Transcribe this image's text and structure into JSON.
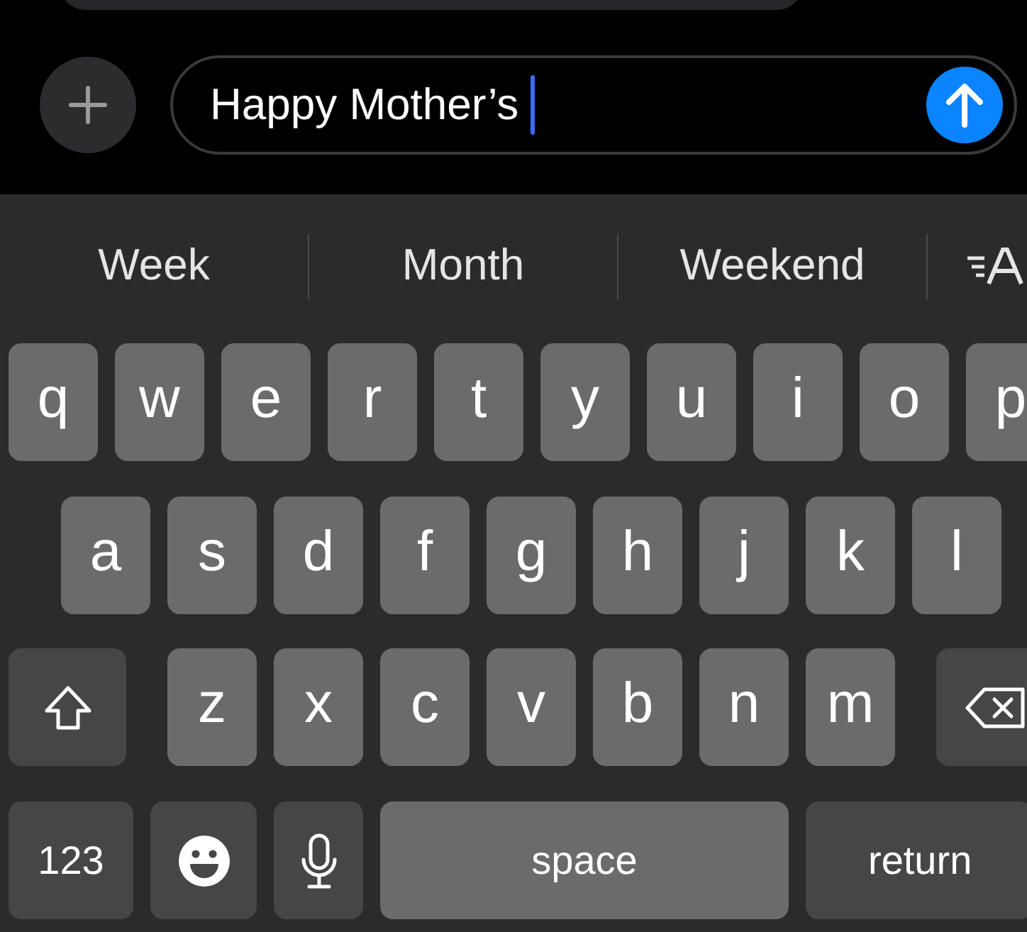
{
  "composer": {
    "value": "Happy Mother’s"
  },
  "suggestions": [
    "Week",
    "Month",
    "Weekend"
  ],
  "keyboard": {
    "rows": [
      {
        "keys": [
          {
            "kind": "letter",
            "label": "q"
          },
          {
            "kind": "letter",
            "label": "w"
          },
          {
            "kind": "letter",
            "label": "e"
          },
          {
            "kind": "letter",
            "label": "r"
          },
          {
            "kind": "letter",
            "label": "t"
          },
          {
            "kind": "letter",
            "label": "y"
          },
          {
            "kind": "letter",
            "label": "u"
          },
          {
            "kind": "letter",
            "label": "i"
          },
          {
            "kind": "letter",
            "label": "o"
          },
          {
            "kind": "letter",
            "label": "p"
          }
        ]
      },
      {
        "keys": [
          {
            "kind": "letter",
            "label": "a"
          },
          {
            "kind": "letter",
            "label": "s"
          },
          {
            "kind": "letter",
            "label": "d"
          },
          {
            "kind": "letter",
            "label": "f"
          },
          {
            "kind": "letter",
            "label": "g"
          },
          {
            "kind": "letter",
            "label": "h"
          },
          {
            "kind": "letter",
            "label": "j"
          },
          {
            "kind": "letter",
            "label": "k"
          },
          {
            "kind": "letter",
            "label": "l"
          }
        ]
      },
      {
        "keys": [
          {
            "kind": "shift"
          },
          {
            "kind": "letter",
            "label": "z"
          },
          {
            "kind": "letter",
            "label": "x"
          },
          {
            "kind": "letter",
            "label": "c"
          },
          {
            "kind": "letter",
            "label": "v"
          },
          {
            "kind": "letter",
            "label": "b"
          },
          {
            "kind": "letter",
            "label": "n"
          },
          {
            "kind": "letter",
            "label": "m"
          },
          {
            "kind": "delete"
          }
        ]
      },
      {
        "keys": [
          {
            "kind": "mode",
            "label": "123"
          },
          {
            "kind": "emoji"
          },
          {
            "kind": "mic"
          },
          {
            "kind": "space",
            "label": "space"
          },
          {
            "kind": "return",
            "label": "return"
          }
        ]
      }
    ]
  }
}
